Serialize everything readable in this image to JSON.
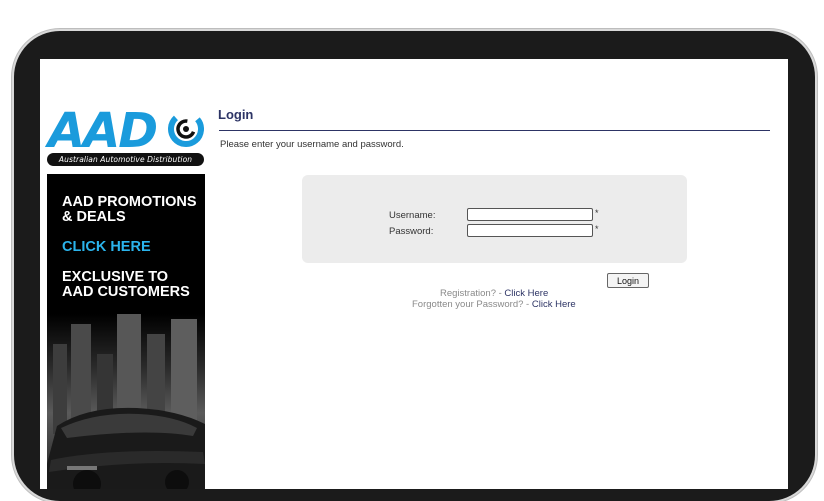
{
  "logo": {
    "brand": "AAD",
    "tagline": "Australian Automotive Distribution"
  },
  "promo": {
    "heading": "AAD PROMOTIONS & DEALS",
    "cta": "CLICK HERE",
    "subheading": "EXCLUSIVE TO AAD CUSTOMERS"
  },
  "page": {
    "title": "Login",
    "instructions": "Please enter your username and password."
  },
  "form": {
    "username_label": "Username:",
    "password_label": "Password:",
    "username_value": "",
    "password_value": "",
    "required_marker": "*",
    "login_label": "Login"
  },
  "links": {
    "registration_text": "Registration? -",
    "registration_link": "Click Here",
    "forgot_text": "Forgotten your Password? -",
    "forgot_link": "Click Here"
  },
  "colors": {
    "brand_blue": "#1a9bdc",
    "heading_navy": "#2d3465",
    "panel_gray": "#ececec"
  }
}
